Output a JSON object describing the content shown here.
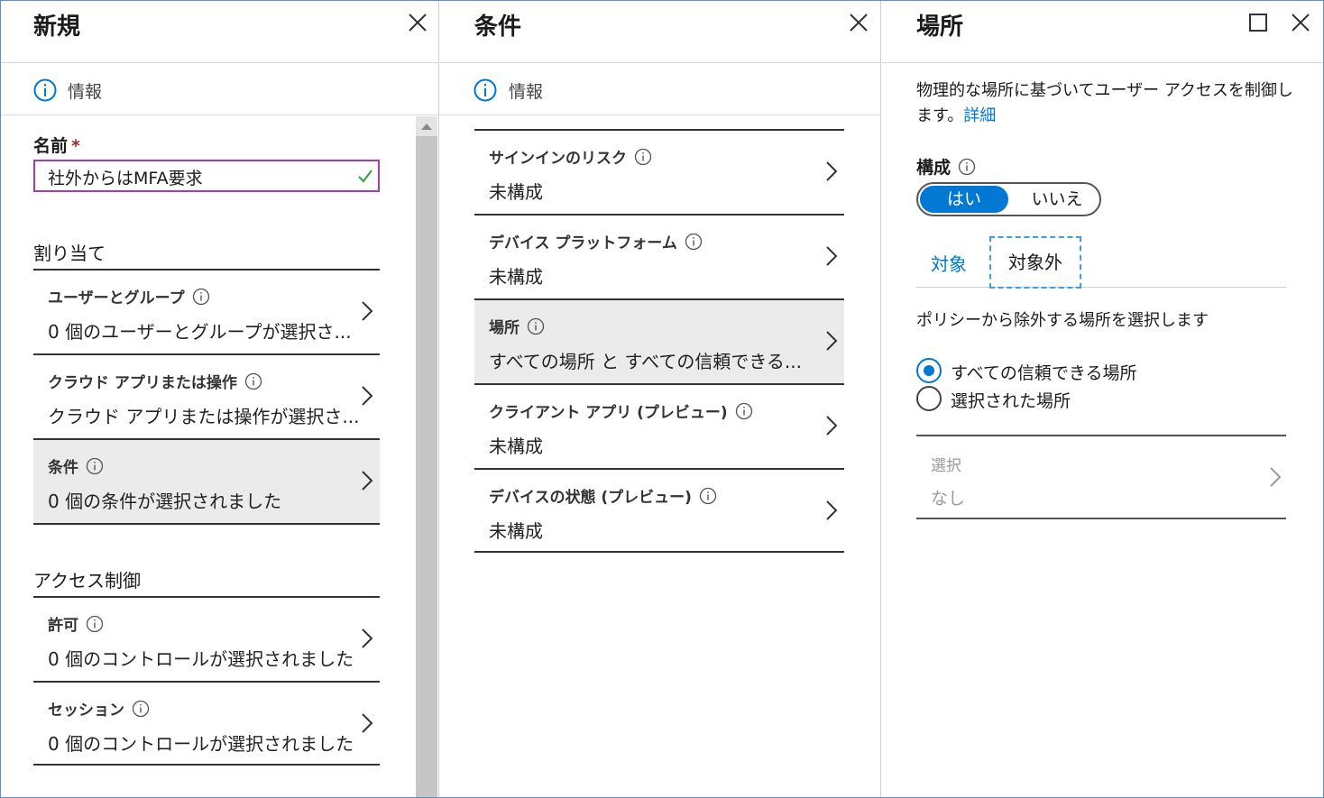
{
  "panel_new": {
    "title": "新規",
    "info": "情報",
    "name_label": "名前",
    "required_mark": "*",
    "name_value": "社外からはMFA要求",
    "assignments_heading": "割り当て",
    "access_heading": "アクセス制御",
    "items": [
      {
        "title": "ユーザーとグループ",
        "value": "0 個のユーザーとグループが選択さ..."
      },
      {
        "title": "クラウド アプリまたは操作",
        "value": "クラウド アプリまたは操作が選択さ..."
      },
      {
        "title": "条件",
        "value": "0 個の条件が選択されました"
      },
      {
        "title": "許可",
        "value": "0 個のコントロールが選択されました"
      },
      {
        "title": "セッション",
        "value": "0 個のコントロールが選択されました"
      }
    ]
  },
  "panel_conditions": {
    "title": "条件",
    "info": "情報",
    "items": [
      {
        "title": "サインインのリスク",
        "value": "未構成"
      },
      {
        "title": "デバイス プラットフォーム",
        "value": "未構成"
      },
      {
        "title": "場所",
        "value": "すべての場所 と すべての信頼できる..."
      },
      {
        "title": "クライアント アプリ (プレビュー)",
        "value": "未構成"
      },
      {
        "title": "デバイスの状態 (プレビュー)",
        "value": "未構成"
      }
    ]
  },
  "panel_locations": {
    "title": "場所",
    "description": "物理的な場所に基づいてユーザー アクセスを制御します。",
    "details_link": "詳細",
    "configure_label": "構成",
    "toggle": {
      "yes": "はい",
      "no": "いいえ",
      "selected": "はい"
    },
    "tabs": {
      "include": "対象",
      "exclude": "対象外",
      "active": "対象外"
    },
    "exclude_description": "ポリシーから除外する場所を選択します",
    "radio_options": [
      {
        "label": "すべての信頼できる場所",
        "checked": true
      },
      {
        "label": "選択された場所",
        "checked": false
      }
    ],
    "select": {
      "title": "選択",
      "value": "なし"
    }
  },
  "colors": {
    "accent": "#0078d4",
    "name_border": "#a13dbd",
    "required": "#a4262c",
    "selected_row": "#ebebeb",
    "check": "#2e9e3e"
  }
}
